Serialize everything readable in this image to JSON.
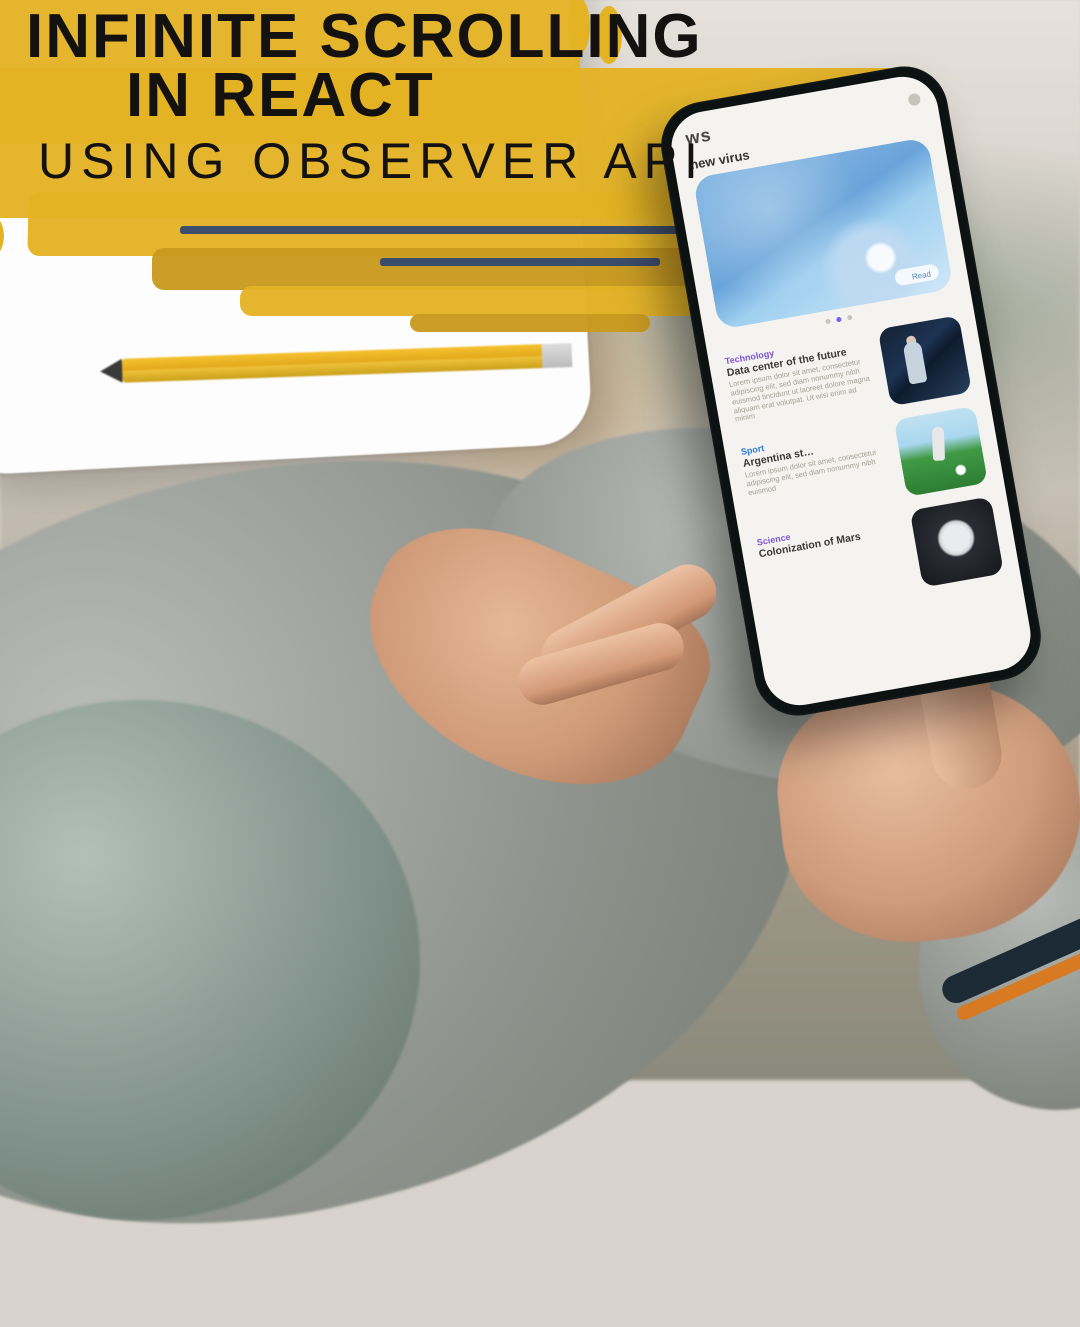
{
  "colors": {
    "brush": "#e4b324",
    "brush_dark": "#c99a1e",
    "blue_accent": "#2b4475"
  },
  "title": {
    "line1": "INFINITE SCROLLING",
    "line2": "IN REACT",
    "line3": "USING OBSERVER API"
  },
  "phone": {
    "app_title": "ws",
    "hero": {
      "headline": "new virus",
      "read_label": "Read"
    },
    "items": [
      {
        "category": "Technology",
        "title": "Data center of the future",
        "lorem": "Lorem ipsum dolor sit amet, consectetur adipiscing elit, sed diam nonummy nibh euismod tincidunt ut laoreet dolore magna aliquam erat volutpat. Ut wisi enim ad minim"
      },
      {
        "category": "Sport",
        "title": "Argentina st…",
        "lorem": "Lorem ipsum dolor sit amet, consectetur adipiscing elit, sed diam nonummy nibh euismod"
      },
      {
        "category": "Science",
        "title": "Colonization of Mars"
      }
    ]
  }
}
